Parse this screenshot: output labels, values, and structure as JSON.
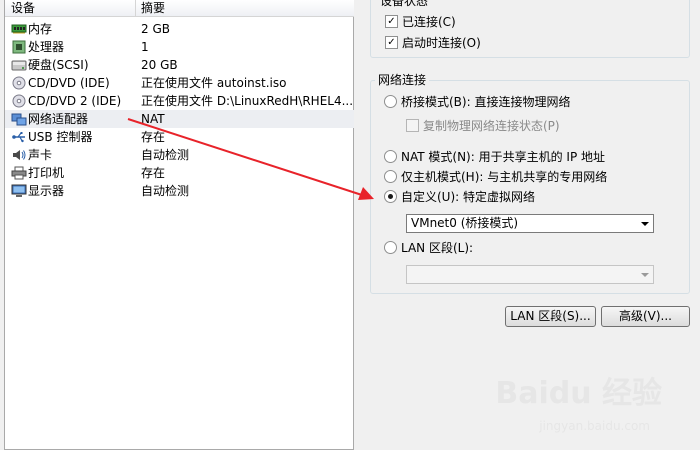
{
  "device_list": {
    "col_device": "设备",
    "col_summary": "摘要",
    "rows": [
      {
        "name": "内存",
        "summary": "2 GB",
        "icon": "memory-icon"
      },
      {
        "name": "处理器",
        "summary": "1",
        "icon": "processor-icon"
      },
      {
        "name": "硬盘(SCSI)",
        "summary": "20 GB",
        "icon": "harddisk-icon"
      },
      {
        "name": "CD/DVD (IDE)",
        "summary": "正在使用文件 autoinst.iso",
        "icon": "cd-dvd-icon"
      },
      {
        "name": "CD/DVD 2 (IDE)",
        "summary": "正在使用文件 D:\\LinuxRedH\\RHEL4....",
        "icon": "cd-dvd-icon"
      },
      {
        "name": "网络适配器",
        "summary": "NAT",
        "icon": "network-adapter-icon"
      },
      {
        "name": "USB 控制器",
        "summary": "存在",
        "icon": "usb-icon"
      },
      {
        "name": "声卡",
        "summary": "自动检测",
        "icon": "sound-card-icon"
      },
      {
        "name": "打印机",
        "summary": "存在",
        "icon": "printer-icon"
      },
      {
        "name": "显示器",
        "summary": "自动检测",
        "icon": "display-icon"
      }
    ]
  },
  "device_status": {
    "legend": "设备状态",
    "connected": {
      "label": "已连接(C)",
      "checked": true
    },
    "connect_at_power_on": {
      "label": "启动时连接(O)",
      "checked": true
    }
  },
  "network_connection": {
    "legend": "网络连接",
    "bridged": {
      "label": "桥接模式(B): 直接连接物理网络"
    },
    "replicate": {
      "label": "复制物理网络连接状态(P)"
    },
    "nat": {
      "label": "NAT 模式(N): 用于共享主机的 IP 地址"
    },
    "host_only": {
      "label": "仅主机模式(H): 与主机共享的专用网络"
    },
    "custom": {
      "label": "自定义(U): 特定虚拟网络",
      "selected": true
    },
    "custom_select": "VMnet0 (桥接模式)",
    "lan_segment": {
      "label": "LAN 区段(L):"
    },
    "lan_select": ""
  },
  "buttons": {
    "lan_segments": "LAN 区段(S)...",
    "advanced": "高级(V)..."
  },
  "watermark": {
    "text": "Baidu 经验",
    "sub": "jingyan.baidu.com"
  },
  "colors": {
    "arrow": "#e8232a"
  }
}
